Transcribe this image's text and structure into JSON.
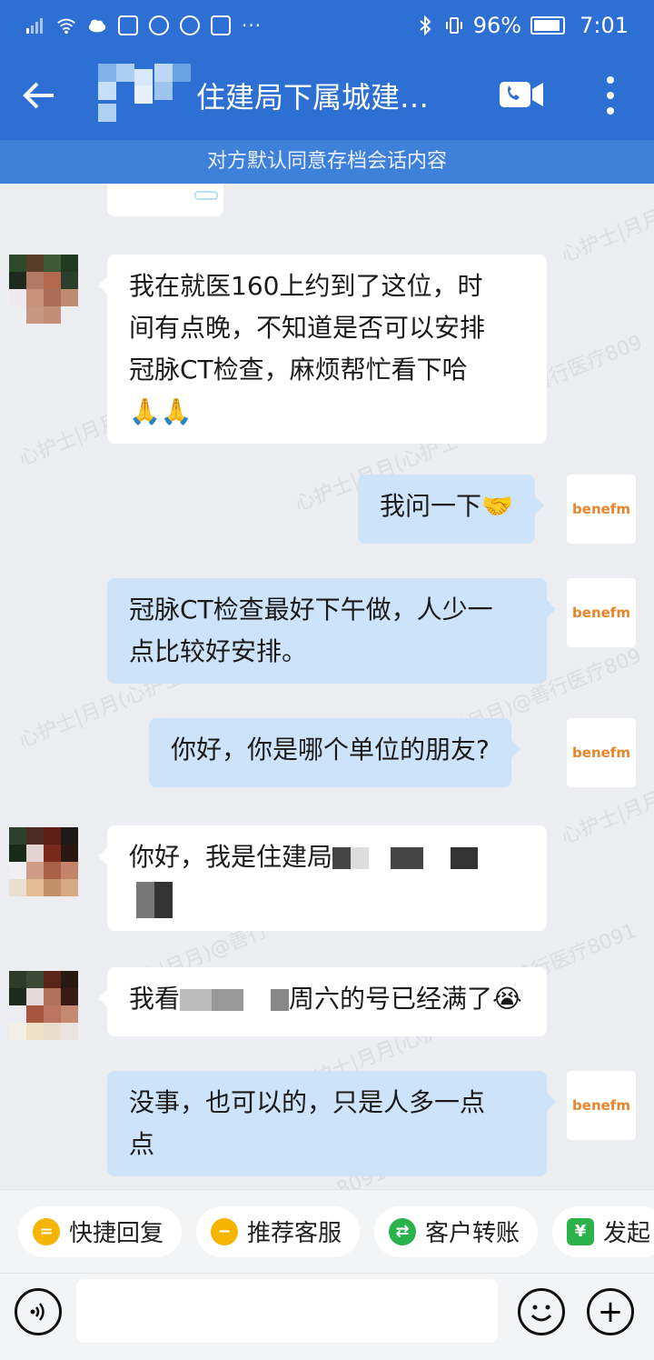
{
  "status_bar": {
    "battery": "96%",
    "time": "7:01",
    "icons": [
      "signal-icon",
      "wifi-icon",
      "cloud-icon",
      "weather-icon",
      "music-icon",
      "browser-icon",
      "upload-icon",
      "more-dots-icon",
      "bluetooth-icon",
      "vibrate-icon",
      "battery-icon"
    ]
  },
  "header": {
    "title": "住建局下属城建…",
    "notice": "对方默认同意存档会话内容"
  },
  "agent_logo": "benefm",
  "watermark_texts": [
    "心护士|月月",
    "心护士|月月(心护士",
    "善行医疗809",
    "心护士|月月(心护士",
    "|月月)@善行医疗809",
    "心护士|月月(心护士",
    "士|月月)@善行",
    "善行医疗8091",
    "心护士|月月",
    "心护士|月月(心护士",
    "8091"
  ],
  "messages": [
    {
      "side": "in",
      "lines": [
        "我在就医160上约到了这位，时",
        "间有点晚，不知道是否可以安排",
        "冠脉CT检查，麻烦帮忙看下哈"
      ],
      "emoji": "🙏🙏"
    },
    {
      "side": "out",
      "text": "我问一下",
      "emoji": "🤝"
    },
    {
      "side": "out",
      "lines": [
        "冠脉CT检查最好下午做，人少一",
        "点比较好安排。"
      ]
    },
    {
      "side": "out",
      "text": "你好，你是哪个单位的朋友?"
    },
    {
      "side": "in",
      "text": "你好，我是住建局"
    },
    {
      "side": "in",
      "text_a": "我看",
      "text_b": "周六的号已经满了",
      "emoji": "😭"
    },
    {
      "side": "out",
      "lines": [
        "没事，也可以的，只是人多一点",
        "点"
      ]
    }
  ],
  "quick_actions": [
    {
      "label": "快捷回复",
      "icon": "quick-reply-icon",
      "color": "#f5b400"
    },
    {
      "label": "推荐客服",
      "icon": "recommend-service-icon",
      "color": "#f5b400"
    },
    {
      "label": "客户转账",
      "icon": "transfer-icon",
      "color": "#2bb24c"
    },
    {
      "label": "发起",
      "icon": "payment-shield-icon",
      "color": "#2bb24c"
    }
  ],
  "input": {
    "placeholder": ""
  }
}
